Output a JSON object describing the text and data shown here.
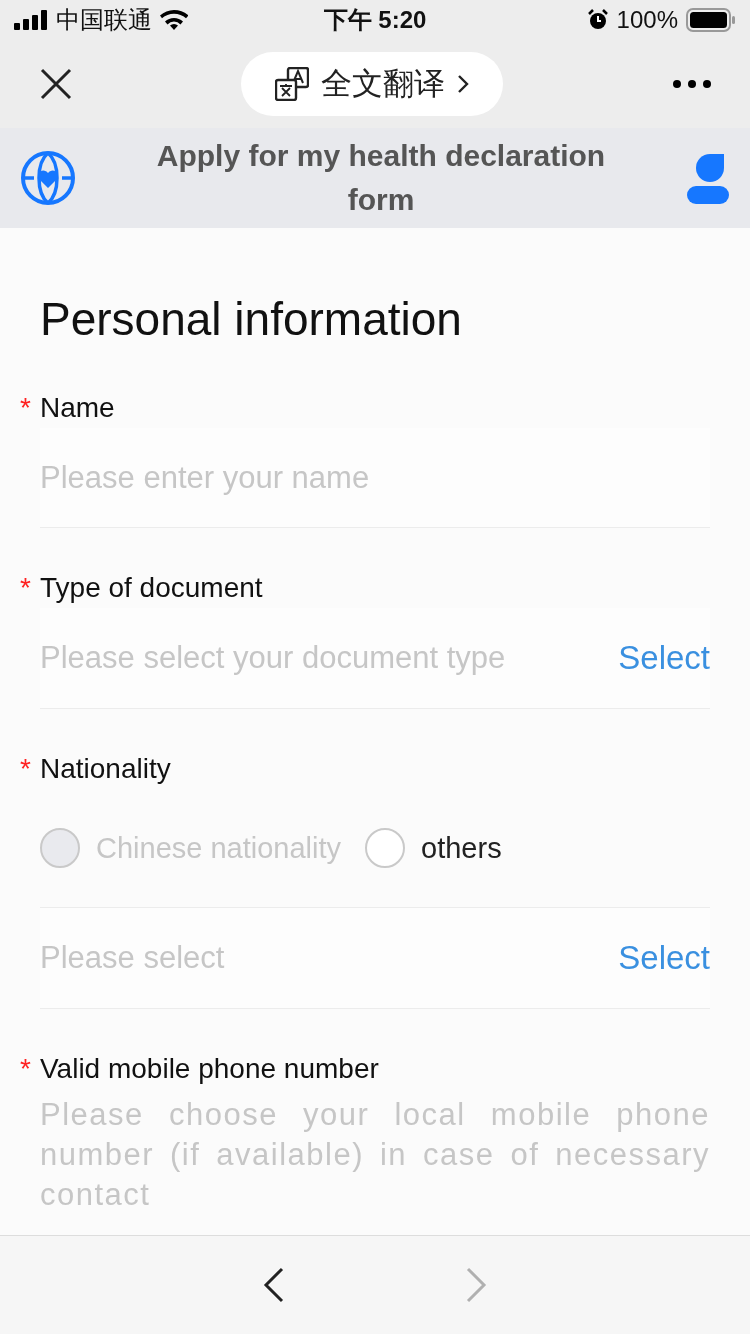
{
  "status_bar": {
    "carrier": "中国联通",
    "time": "下午 5:20",
    "battery": "100%"
  },
  "nav": {
    "translate_label": "全文翻译"
  },
  "header": {
    "title": "Apply for my health declaration form"
  },
  "section_title": "Personal information",
  "fields": [
    {
      "kind": "input",
      "label": "Name",
      "required_mark": "*",
      "placeholder": "Please enter your name"
    },
    {
      "kind": "select",
      "label": "Type of document",
      "required_mark": "*",
      "placeholder": "Please select your document type",
      "action": "Select"
    },
    {
      "kind": "radio",
      "label": "Nationality",
      "required_mark": "*",
      "options": [
        {
          "label": "Chinese nationality",
          "selected": false,
          "disabled": true
        },
        {
          "label": "others",
          "selected": false,
          "disabled": false
        }
      ],
      "select": {
        "placeholder": "Please select",
        "action": "Select"
      }
    },
    {
      "kind": "textarea",
      "label": "Valid mobile phone number",
      "required_mark": "*",
      "placeholder": "Please choose your local mobile phone number (if available) in case of necessary contact"
    }
  ],
  "toolbar": {
    "back_disabled": false,
    "forward_disabled": true
  }
}
